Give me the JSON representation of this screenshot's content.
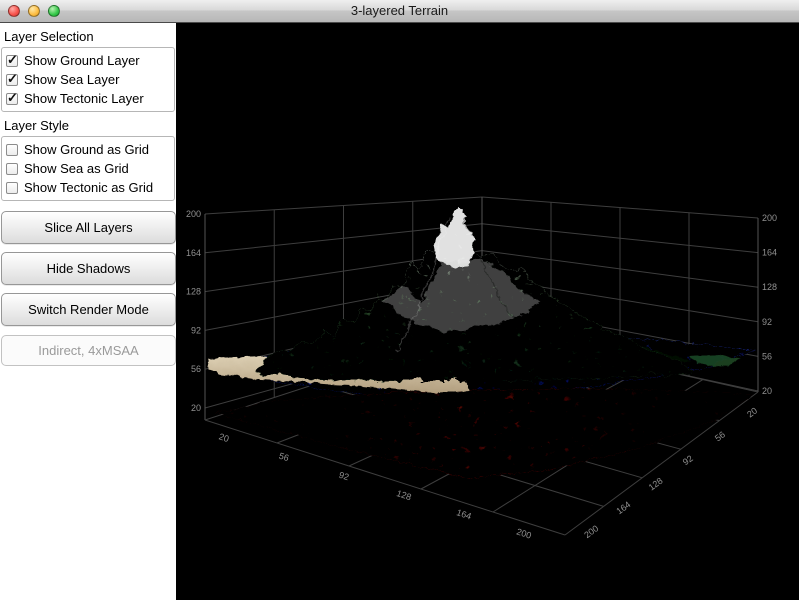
{
  "window": {
    "title": "3-layered Terrain"
  },
  "sidebar": {
    "sections": [
      {
        "heading": "Layer Selection",
        "items": [
          {
            "label": "Show Ground Layer",
            "checked": true
          },
          {
            "label": "Show Sea Layer",
            "checked": true
          },
          {
            "label": "Show Tectonic Layer",
            "checked": true
          }
        ]
      },
      {
        "heading": "Layer Style",
        "items": [
          {
            "label": "Show Ground as Grid",
            "checked": false
          },
          {
            "label": "Show Sea as Grid",
            "checked": false
          },
          {
            "label": "Show Tectonic as Grid",
            "checked": false
          }
        ]
      }
    ],
    "buttons": [
      {
        "label": "Slice All Layers"
      },
      {
        "label": "Hide Shadows"
      },
      {
        "label": "Switch Render Mode"
      }
    ],
    "status": "Indirect, 4xMSAA"
  },
  "viewport": {
    "left_axis_ticks": [
      "200",
      "164",
      "128",
      "92",
      "56",
      "20"
    ],
    "right_axis_ticks": [
      "200",
      "164",
      "128",
      "92",
      "56",
      "20"
    ],
    "floor_left_ticks": [
      "20",
      "56",
      "92",
      "128",
      "164",
      "200"
    ],
    "floor_right_ticks": [
      "20",
      "56",
      "92",
      "128",
      "164",
      "200"
    ],
    "colors": {
      "background": "#000000",
      "grid": "#3e3e3e",
      "axis": "#555555",
      "tick_text": "#909090",
      "sea": "#1f2fc0",
      "ground_low": "#2a5a34",
      "ground_high": "#f5f7f5",
      "tectonic": "#8e1a14",
      "sand": "#cfc0a4"
    }
  }
}
